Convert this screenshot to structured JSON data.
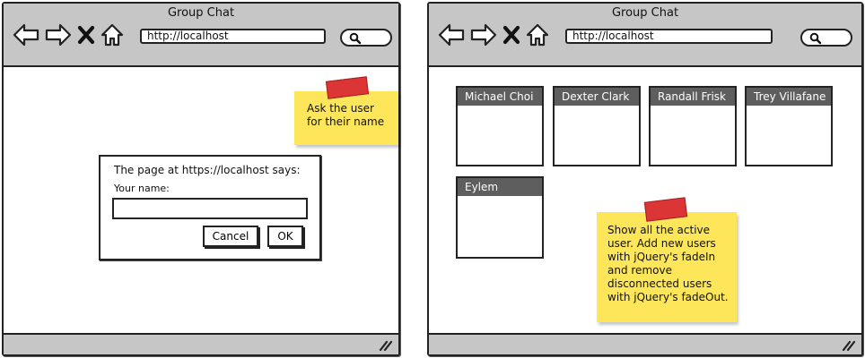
{
  "window_title": "Group Chat",
  "address_bar": {
    "url": "http://localhost"
  },
  "prompt_page": {
    "sticky_note": {
      "text": "Ask the user\nfor their name"
    },
    "dialog": {
      "message": "The page at https://localhost says:",
      "field_label": "Your name:",
      "field_value": "",
      "cancel_label": "Cancel",
      "ok_label": "OK"
    }
  },
  "users_page": {
    "users": [
      {
        "name": "Michael Choi"
      },
      {
        "name": "Dexter Clark"
      },
      {
        "name": "Randall Frisk"
      },
      {
        "name": "Trey Villafane"
      },
      {
        "name": "Eylem"
      }
    ],
    "sticky_note": {
      "text": "Show all the active\nuser.  Add new users\nwith jQuery's fadeIn\nand remove\ndisconnected users\nwith jQuery's fadeOut."
    }
  },
  "colors": {
    "chrome": "#c6c6c6",
    "sticky_note": "#fde65a",
    "tape": "#dc3535",
    "card_header": "#5e5e5e"
  },
  "icons": [
    "back-arrow-icon",
    "forward-arrow-icon",
    "close-x-icon",
    "home-icon",
    "search-icon",
    "resize-grip-icon"
  ]
}
